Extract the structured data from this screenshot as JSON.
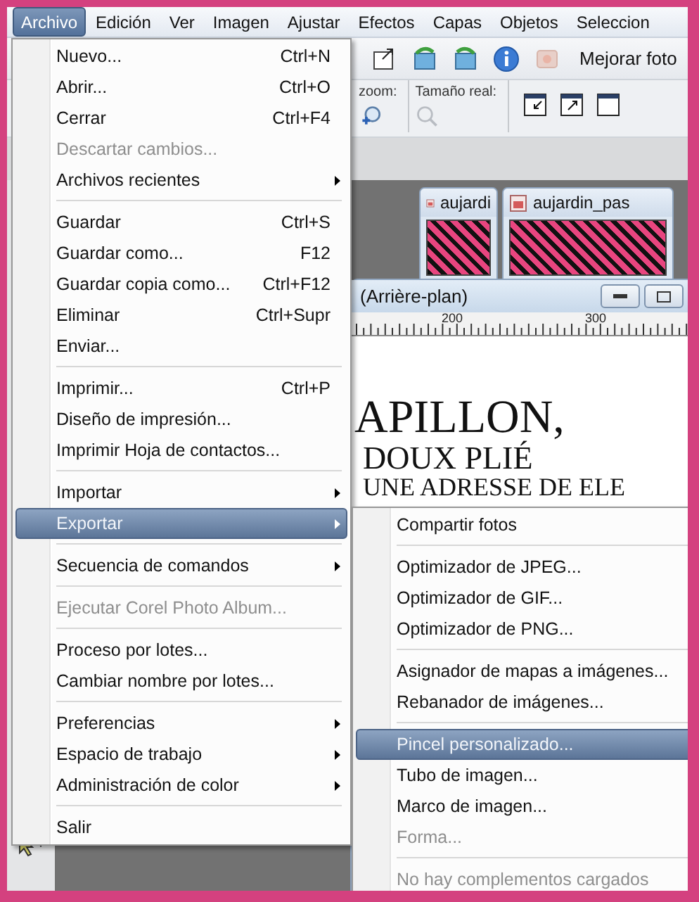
{
  "menubar": [
    {
      "label": "Archivo",
      "selected": true
    },
    {
      "label": "Edición",
      "selected": false
    },
    {
      "label": "Ver",
      "selected": false
    },
    {
      "label": "Imagen",
      "selected": false
    },
    {
      "label": "Ajustar",
      "selected": false
    },
    {
      "label": "Efectos",
      "selected": false
    },
    {
      "label": "Capas",
      "selected": false
    },
    {
      "label": "Objetos",
      "selected": false
    },
    {
      "label": "Seleccion",
      "selected": false
    }
  ],
  "toolbar": {
    "enhance_label": "Mejorar foto"
  },
  "zoom_toolbar": {
    "zoom_label": "zoom:",
    "actual_size_label": "Tamaño real:"
  },
  "image_tabs": [
    {
      "label": "aujardi"
    },
    {
      "label": "aujardin_pas"
    }
  ],
  "document_window": {
    "title": "(Arrière-plan)",
    "ruler_labels": [
      "200",
      "300"
    ],
    "canvas_lines": [
      "APILLON,",
      "DOUX PLIÉ",
      "UNE ADRESSE DE ELE"
    ]
  },
  "file_menu": [
    {
      "kind": "item",
      "label": "Nuevo...",
      "shortcut": "Ctrl+N",
      "disabled": false,
      "submenu": false,
      "selected": false
    },
    {
      "kind": "item",
      "label": "Abrir...",
      "shortcut": "Ctrl+O",
      "disabled": false,
      "submenu": false,
      "selected": false
    },
    {
      "kind": "item",
      "label": "Cerrar",
      "shortcut": "Ctrl+F4",
      "disabled": false,
      "submenu": false,
      "selected": false
    },
    {
      "kind": "item",
      "label": "Descartar cambios...",
      "disabled": true,
      "submenu": false,
      "selected": false
    },
    {
      "kind": "item",
      "label": "Archivos recientes",
      "disabled": false,
      "submenu": true,
      "selected": false
    },
    {
      "kind": "separator"
    },
    {
      "kind": "item",
      "label": "Guardar",
      "shortcut": "Ctrl+S",
      "disabled": false,
      "submenu": false,
      "selected": false
    },
    {
      "kind": "item",
      "label": "Guardar como...",
      "shortcut": "F12",
      "disabled": false,
      "submenu": false,
      "selected": false
    },
    {
      "kind": "item",
      "label": "Guardar copia como...",
      "shortcut": "Ctrl+F12",
      "disabled": false,
      "submenu": false,
      "selected": false
    },
    {
      "kind": "item",
      "label": "Eliminar",
      "shortcut": "Ctrl+Supr",
      "disabled": false,
      "submenu": false,
      "selected": false
    },
    {
      "kind": "item",
      "label": "Enviar...",
      "disabled": false,
      "submenu": false,
      "selected": false
    },
    {
      "kind": "separator"
    },
    {
      "kind": "item",
      "label": "Imprimir...",
      "shortcut": "Ctrl+P",
      "disabled": false,
      "submenu": false,
      "selected": false
    },
    {
      "kind": "item",
      "label": "Diseño de impresión...",
      "disabled": false,
      "submenu": false,
      "selected": false
    },
    {
      "kind": "item",
      "label": "Imprimir Hoja de contactos...",
      "disabled": false,
      "submenu": false,
      "selected": false
    },
    {
      "kind": "separator"
    },
    {
      "kind": "item",
      "label": "Importar",
      "disabled": false,
      "submenu": true,
      "selected": false
    },
    {
      "kind": "item",
      "label": "Exportar",
      "disabled": false,
      "submenu": true,
      "selected": true
    },
    {
      "kind": "separator"
    },
    {
      "kind": "item",
      "label": "Secuencia de comandos",
      "disabled": false,
      "submenu": true,
      "selected": false
    },
    {
      "kind": "separator"
    },
    {
      "kind": "item",
      "label": "Ejecutar Corel Photo Album...",
      "disabled": true,
      "submenu": false,
      "selected": false
    },
    {
      "kind": "separator"
    },
    {
      "kind": "item",
      "label": "Proceso por lotes...",
      "disabled": false,
      "submenu": false,
      "selected": false
    },
    {
      "kind": "item",
      "label": "Cambiar nombre por lotes...",
      "disabled": false,
      "submenu": false,
      "selected": false
    },
    {
      "kind": "separator"
    },
    {
      "kind": "item",
      "label": "Preferencias",
      "disabled": false,
      "submenu": true,
      "selected": false
    },
    {
      "kind": "item",
      "label": "Espacio de trabajo",
      "disabled": false,
      "submenu": true,
      "selected": false
    },
    {
      "kind": "item",
      "label": "Administración de color",
      "disabled": false,
      "submenu": true,
      "selected": false
    },
    {
      "kind": "separator"
    },
    {
      "kind": "item",
      "label": "Salir",
      "disabled": false,
      "submenu": false,
      "selected": false
    }
  ],
  "export_submenu": [
    {
      "kind": "item",
      "label": "Compartir fotos",
      "disabled": false,
      "selected": false
    },
    {
      "kind": "separator"
    },
    {
      "kind": "item",
      "label": "Optimizador de JPEG...",
      "disabled": false,
      "selected": false
    },
    {
      "kind": "item",
      "label": "Optimizador de GIF...",
      "disabled": false,
      "selected": false
    },
    {
      "kind": "item",
      "label": "Optimizador de PNG...",
      "disabled": false,
      "selected": false
    },
    {
      "kind": "separator"
    },
    {
      "kind": "item",
      "label": "Asignador de mapas a imágenes...",
      "disabled": false,
      "selected": false
    },
    {
      "kind": "item",
      "label": "Rebanador de imágenes...",
      "disabled": false,
      "selected": false
    },
    {
      "kind": "separator"
    },
    {
      "kind": "item",
      "label": "Pincel personalizado...",
      "disabled": false,
      "selected": true
    },
    {
      "kind": "item",
      "label": "Tubo de imagen...",
      "disabled": false,
      "selected": false
    },
    {
      "kind": "item",
      "label": "Marco de imagen...",
      "disabled": false,
      "selected": false
    },
    {
      "kind": "item",
      "label": "Forma...",
      "disabled": true,
      "selected": false
    },
    {
      "kind": "separator"
    },
    {
      "kind": "item",
      "label": "No hay complementos cargados",
      "disabled": true,
      "selected": false
    }
  ]
}
